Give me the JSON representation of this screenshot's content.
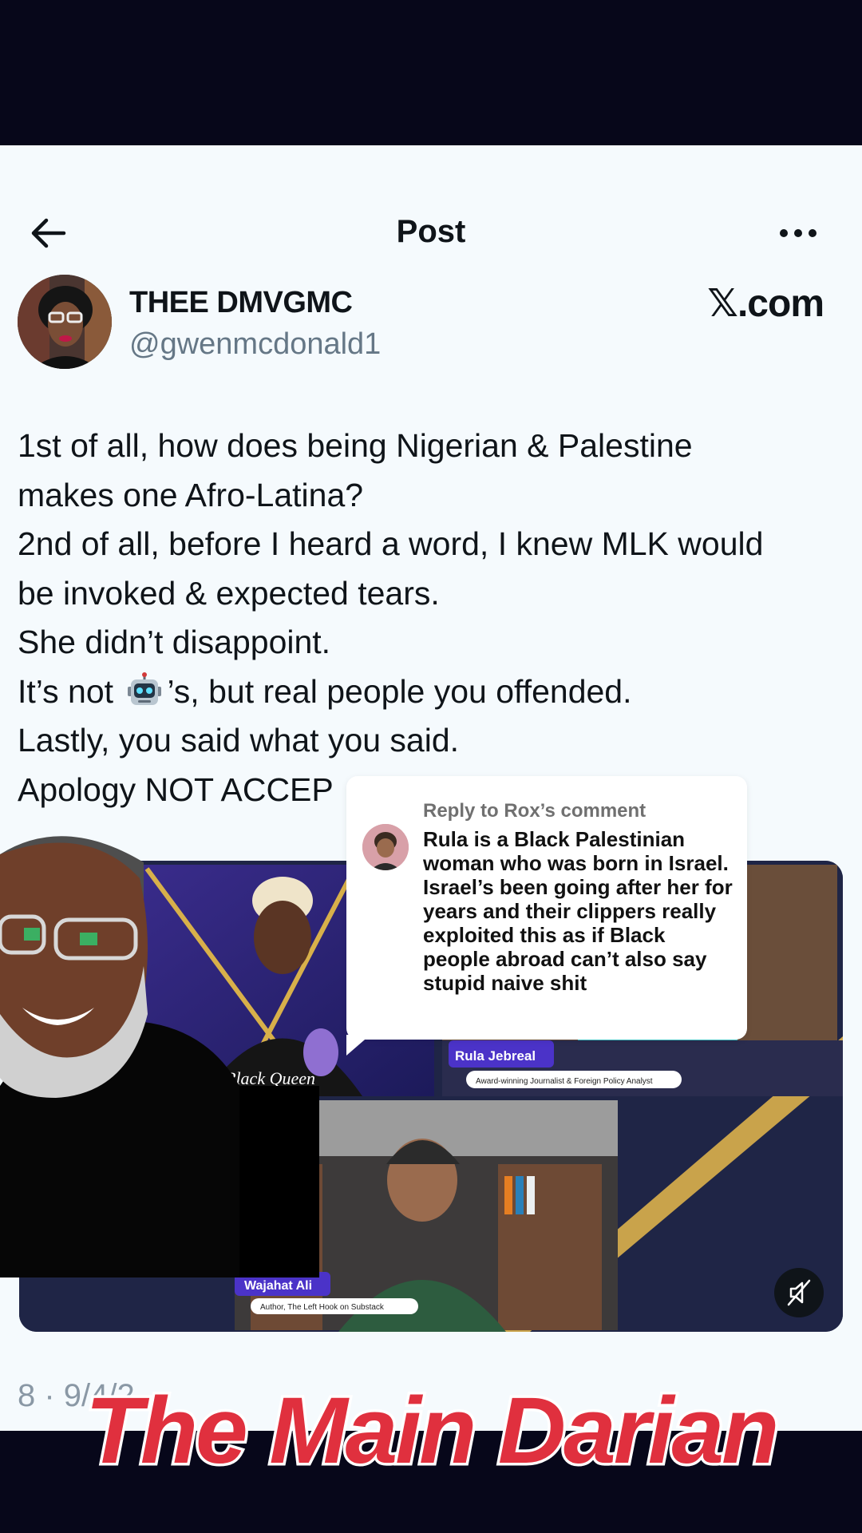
{
  "nav": {
    "title": "Post",
    "back_icon": "arrow-left-icon",
    "more_icon": "more-horizontal-icon"
  },
  "author": {
    "display_name": "THEE DMVGMC",
    "handle": "@gwenmcdonald1"
  },
  "brand": "𝕏.com",
  "tweet": {
    "line1": "1st of all, how does being Nigerian & Palestine",
    "line2": "makes one Afro-Latina?",
    "line3": "2nd of all, before I heard a word, I knew MLK would",
    "line4": "be invoked & expected tears.",
    "line5": "She didn’t disappoint.",
    "line6_before": "It’s not ",
    "line6_after": "’s, but real people you offended.",
    "line7": "Lastly, you said what you said.",
    "line8": "Apology NOT ACCEP",
    "emoji": "robot-face-icon"
  },
  "media": {
    "left_badge": "Black Queen",
    "right_name": "Rula Jebreal",
    "right_title": "Award-winning Journalist & Foreign Policy Analyst",
    "bottom_name": "Wajahat Ali",
    "bottom_title": "Author, The Left Hook on Substack",
    "mute_icon": "speaker-muted-icon"
  },
  "meta": {
    "partial_text": "8 · 9/4/2"
  },
  "reply_comment": {
    "header": "Reply to Rox’s comment",
    "text": "Rula is a Black Palestinian woman who was born in Israel. Israel’s been going after her for years and their clippers really exploited this as if Black people abroad can’t also say stupid naive shit"
  },
  "watermark": "The Main Darian",
  "colors": {
    "watermark_fill": "#e0303e",
    "watermark_stroke": "#ffffff",
    "text_primary": "#0f1419",
    "text_secondary": "#657786"
  }
}
